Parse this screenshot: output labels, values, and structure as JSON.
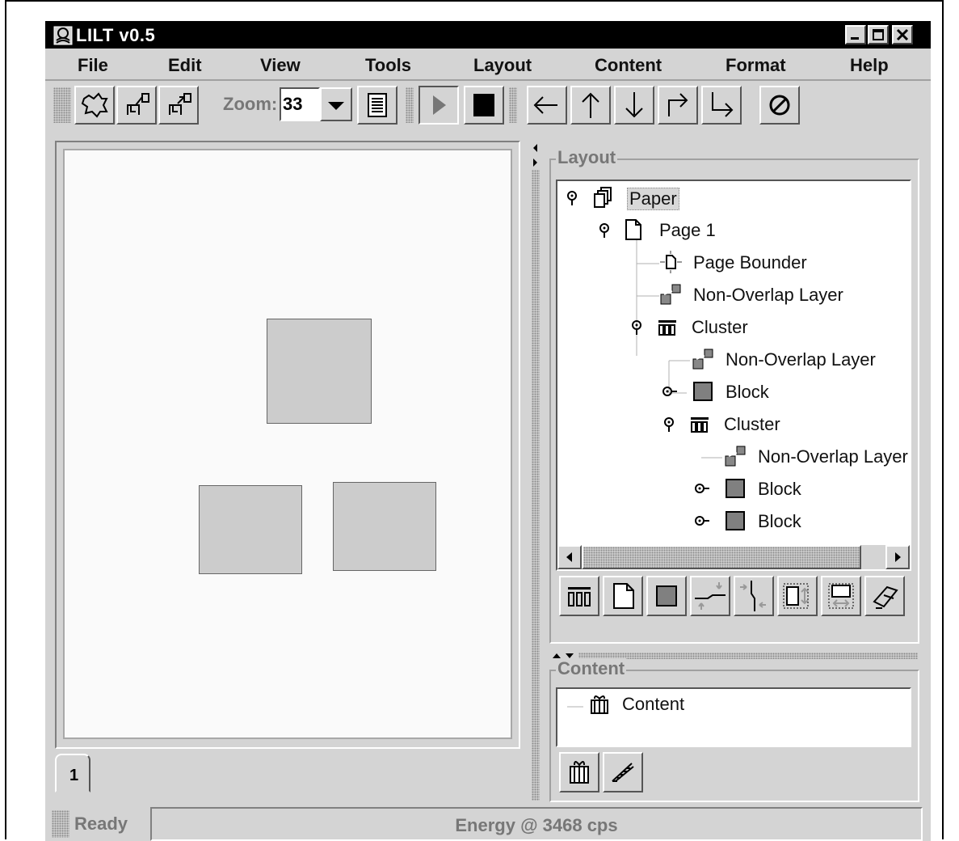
{
  "window": {
    "title": "LILT v0.5",
    "icon": "app-logo-icon",
    "controls": [
      "minimize-icon",
      "maximize-icon",
      "close-icon"
    ]
  },
  "menu": [
    "File",
    "Edit",
    "View",
    "Tools",
    "Layout",
    "Content",
    "Format",
    "Help"
  ],
  "toolbar": {
    "buttons_left": [
      "new-blob-icon",
      "export-layout-icon",
      "import-layout-icon"
    ],
    "zoom_label": "Zoom:",
    "zoom_value": "33",
    "buttons_right": [
      "page-view-icon",
      "play-icon",
      "stop-icon",
      "arrow-left-icon",
      "arrow-up-icon",
      "arrow-down-icon",
      "redo-arrow-icon",
      "return-arrow-icon",
      "cancel-icon"
    ]
  },
  "document": {
    "page_tab": "1",
    "blocks_count": 3
  },
  "layout_panel": {
    "title": "Layout",
    "tree": [
      {
        "label": "Paper",
        "level": 0,
        "icon": "paper-stack-icon",
        "selected": true
      },
      {
        "label": "Page 1",
        "level": 1,
        "icon": "page-icon"
      },
      {
        "label": "Page Bounder",
        "level": 2,
        "icon": "page-bounder-icon"
      },
      {
        "label": "Non-Overlap Layer",
        "level": 2,
        "icon": "non-overlap-icon"
      },
      {
        "label": "Cluster",
        "level": 2,
        "icon": "cluster-icon"
      },
      {
        "label": "Non-Overlap Layer",
        "level": 3,
        "icon": "non-overlap-icon"
      },
      {
        "label": "Block",
        "level": 3,
        "icon": "block-icon"
      },
      {
        "label": "Cluster",
        "level": 3,
        "icon": "cluster-icon"
      },
      {
        "label": "Non-Overlap Layer",
        "level": 4,
        "icon": "non-overlap-icon"
      },
      {
        "label": "Block",
        "level": 4,
        "icon": "block-icon"
      },
      {
        "label": "Block",
        "level": 4,
        "icon": "block-icon"
      }
    ],
    "buttons": [
      "add-cluster-icon",
      "add-page-icon",
      "add-block-icon",
      "horizontal-constraint-icon",
      "vertical-constraint-icon",
      "fit-vertical-icon",
      "fit-horizontal-icon",
      "eraser-icon"
    ]
  },
  "content_panel": {
    "title": "Content",
    "tree_item": "Content",
    "buttons": [
      "gift-icon",
      "ruler-icon"
    ]
  },
  "status": {
    "ready": "Ready",
    "energy": "Energy @ 3468 cps"
  }
}
